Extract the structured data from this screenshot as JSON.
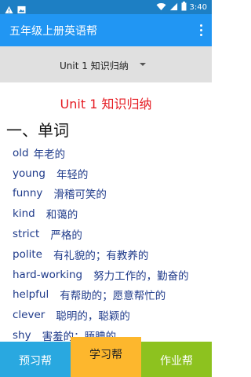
{
  "status_bar": {
    "time": "3:40",
    "left_icons": [
      "warning-icon",
      "image-icon"
    ],
    "right_icons": [
      "wifi-icon",
      "signal-icon",
      "battery-icon"
    ]
  },
  "app_bar": {
    "title": "五年级上册英语帮",
    "menu_icon": "more-vert-icon"
  },
  "selector": {
    "value": "Unit 1 知识归纳"
  },
  "content": {
    "unit_title": "Unit 1 知识归纳",
    "section_title": "一、单词",
    "words": [
      {
        "en": "old",
        "zh": "年老的"
      },
      {
        "en": "young",
        "zh": "年轻的"
      },
      {
        "en": "funny",
        "zh": "滑稽可笑的"
      },
      {
        "en": "kind",
        "zh": "和蔼的"
      },
      {
        "en": "strict",
        "zh": "严格的"
      },
      {
        "en": "polite",
        "zh": "有礼貌的；有教养的"
      },
      {
        "en": "hard-working",
        "zh": "努力工作的，勤奋的"
      },
      {
        "en": "helpful",
        "zh": "有帮助的；愿意帮忙的"
      },
      {
        "en": "clever",
        "zh": "聪明的，聪颖的"
      },
      {
        "en": "shy",
        "zh": "害羞的；腼腆的"
      }
    ]
  },
  "bottom_nav": {
    "preview": "预习帮",
    "study": "学习帮",
    "homework": "作业帮"
  },
  "colors": {
    "status_bar": "#1d7fc4",
    "app_bar": "#2196f3",
    "unit_title": "#e51c23",
    "word_text": "#1e3a8a",
    "nav_preview": "#29a8e0",
    "nav_study": "#fdb72d",
    "nav_homework": "#8dc21f"
  }
}
